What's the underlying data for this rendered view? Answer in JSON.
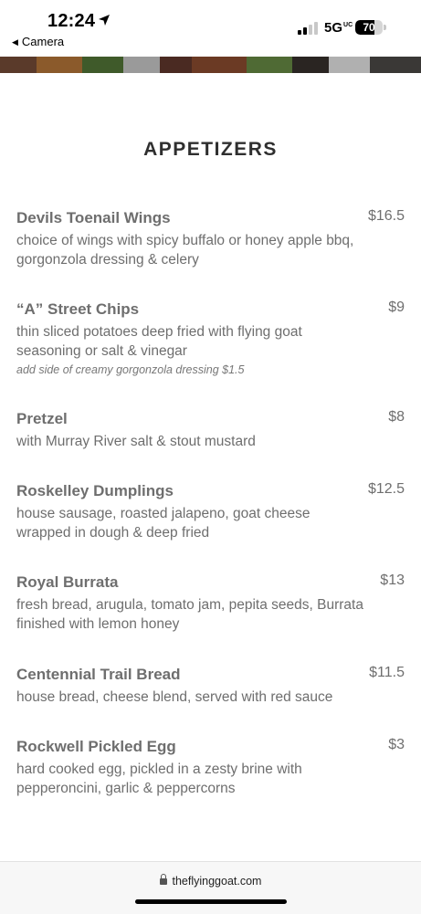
{
  "status_bar": {
    "time": "12:24",
    "back_label": "Camera",
    "network": "5G",
    "network_suffix": "UC",
    "battery_percent": "70",
    "battery_level": 0.7
  },
  "menu": {
    "section_title": "APPETIZERS",
    "items": [
      {
        "name": "Devils Toenail Wings",
        "price": "$16.5",
        "description": "choice of wings with spicy buffalo or honey apple bbq, gorgonzola dressing & celery",
        "note": ""
      },
      {
        "name": "“A” Street Chips",
        "price": "$9",
        "description": "thin sliced potatoes deep fried with flying goat seasoning or salt & vinegar",
        "note": "add side of creamy gorgonzola dressing $1.5"
      },
      {
        "name": "Pretzel",
        "price": "$8",
        "description": "with Murray River salt & stout mustard",
        "note": ""
      },
      {
        "name": "Roskelley Dumplings",
        "price": "$12.5",
        "description": "house sausage, roasted jalapeno, goat cheese wrapped in dough & deep fried",
        "note": ""
      },
      {
        "name": "Royal Burrata",
        "price": "$13",
        "description": "fresh bread, arugula, tomato jam, pepita seeds, Burrata finished with lemon honey",
        "note": ""
      },
      {
        "name": "Centennial Trail Bread",
        "price": "$11.5",
        "description": "house bread, cheese blend, served with red sauce",
        "note": ""
      },
      {
        "name": "Rockwell Pickled Egg",
        "price": "$3",
        "description": "hard cooked egg, pickled in a zesty brine with pepperoncini, garlic & peppercorns",
        "note": ""
      }
    ]
  },
  "browser": {
    "url": "theflyinggoat.com"
  }
}
